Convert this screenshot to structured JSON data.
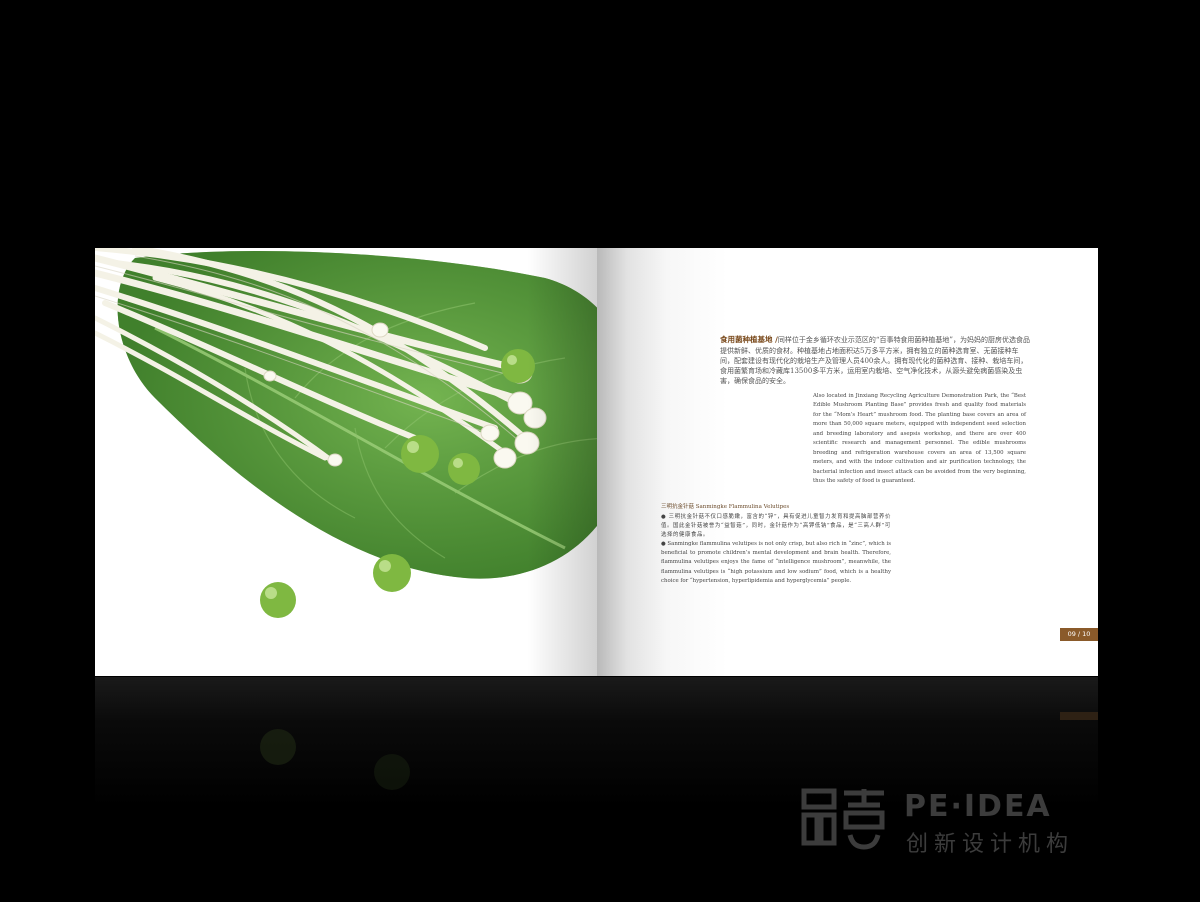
{
  "heading": {
    "title": "食用菌种植基地 /",
    "body": "同样位于金乡循环农业示范区的“百事特食用菌种植基地”，为妈妈的厨房优选食品提供新鲜、优质的食材。种植基地占地面积达5万多平方米，拥有独立的菌种选育室、无菌接种车间，配套建设有现代化的栽培生产及管理人员400余人。拥有现代化的菌种选育、接种、栽培车间，食用菌繁育场和冷藏库13500多平方米，运用室内栽培、空气净化技术，从源头避免病菌感染及虫害，确保食品的安全。"
  },
  "en_paragraph": "Also located in Jinxiang Recycling Agriculture Demonstration Park, the “Best Edible Mushroom Planting Base” provides fresh and quality food materials for the “Mom’s Heart” mushroom food. The planting base covers an area of more than 50,000 square meters, equipped with independent seed selection and breeding laboratory and asepsis workshop, and there are over 400 scientific research and management personnel. The edible mushrooms breeding and refrigeration warehouse covers an area of 13,500 square meters, and with the indoor cultivation and air purification technology, the bacterial infection and insect attack can be avoided from the very beginning, thus the safety of food is guaranteed.",
  "sub": {
    "title": "三明抗金针菇  Sanmingke Flammulina Velutipes",
    "zh": "● 三明抗金针菇不仅口感脆嫩，富含的“锌”，具有促进儿童智力发育和提高脑部营养价值。国此金针菇被誉为“益智菇”，同时，金针菇作为“高钾低钠”食品，是“三高人群”可选择的健康食品。",
    "en": "● Sanmingke flammulina velutipes is not only crisp, but also rich in “zinc”, which is beneficial to promote children’s mental development and brain health. Therefore, flammulina velutipes enjoys the fame of “intelligence mushroom”, meanwhile, the flammulina velutipes is “high potassium and low sodium” food, which is a healthy choice for “hypertension, hyperlipidemia and hyperglycemia” people."
  },
  "folio": "09 / 10",
  "watermark": {
    "logo_text": "品意",
    "en": "PE·IDEA",
    "zh": "创新设计机构"
  }
}
